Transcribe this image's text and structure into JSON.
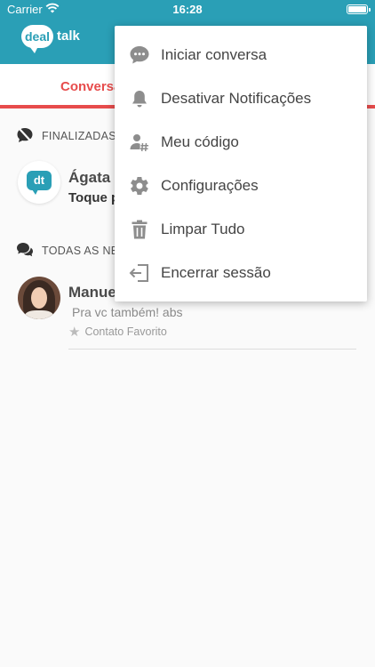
{
  "status_bar": {
    "carrier": "Carrier",
    "time": "16:28"
  },
  "logo": {
    "bubble_text": "deal",
    "word": "talk"
  },
  "tabs": {
    "active_label": "Conversa"
  },
  "sections": {
    "finalized": {
      "label": "FINALIZADAS"
    },
    "all": {
      "label": "TODAS AS NE"
    }
  },
  "conversations": [
    {
      "avatar_text": "dt",
      "name": "Ágata",
      "subtitle": "Toque p"
    },
    {
      "name": "Manue",
      "message": "Pra vc também! abs",
      "favorite_label": "Contato Favorito"
    }
  ],
  "menu": {
    "items": [
      {
        "label": "Iniciar conversa",
        "icon": "chat-bubble-icon"
      },
      {
        "label": "Desativar Notificações",
        "icon": "bell-icon"
      },
      {
        "label": "Meu código",
        "icon": "user-hash-icon"
      },
      {
        "label": "Configurações",
        "icon": "gear-icon"
      },
      {
        "label": "Limpar Tudo",
        "icon": "trash-icon"
      },
      {
        "label": "Encerrar sessão",
        "icon": "logout-icon"
      }
    ]
  },
  "colors": {
    "brand": "#2a9fb6",
    "accent": "#e74c4c",
    "icon_gray": "#8d8d8d"
  }
}
